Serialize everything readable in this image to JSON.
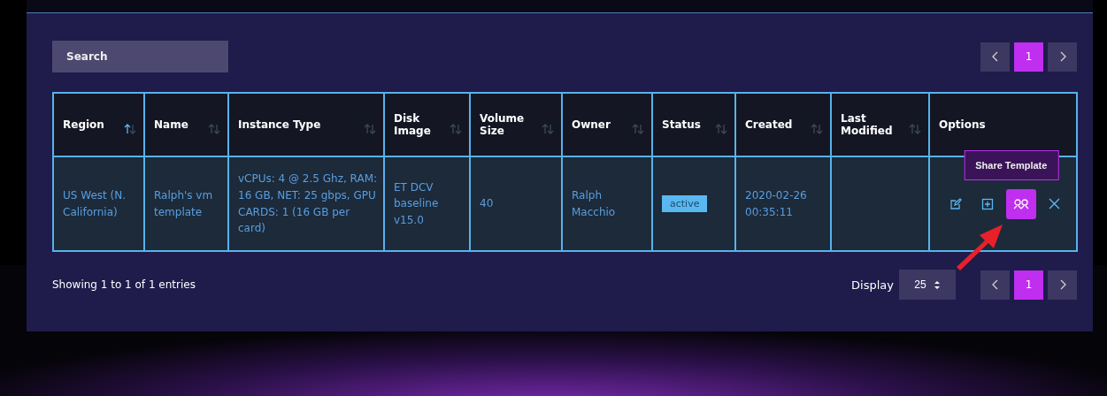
{
  "search": {
    "placeholder": "Search"
  },
  "pagination_top": {
    "pages": [
      {
        "label": "1",
        "selected": true
      }
    ]
  },
  "table": {
    "columns": [
      {
        "label": "Region",
        "sorted": true
      },
      {
        "label": "Name",
        "sorted": false
      },
      {
        "label": "Instance Type",
        "sorted": false
      },
      {
        "label": "Disk Image",
        "sorted": false
      },
      {
        "label": "Volume Size",
        "sorted": false
      },
      {
        "label": "Owner",
        "sorted": false
      },
      {
        "label": "Status",
        "sorted": false
      },
      {
        "label": "Created",
        "sorted": false
      },
      {
        "label": "Last Modified",
        "sorted": false
      },
      {
        "label": "Options"
      }
    ],
    "rows": [
      {
        "region": "US West (N. California)",
        "name": "Ralph's vm template",
        "instance_type": "vCPUs: 4 @ 2.5 Ghz, RAM: 16 GB, NET: 25 gbps, GPU CARDS: 1 (16 GB per card)",
        "disk_image": "ET DCV baseline v15.0",
        "volume_size": "40",
        "owner": "Ralph Macchio",
        "status": "active",
        "created": "2020-02-26 00:35:11",
        "actions": [
          {
            "kind": "edit",
            "highlighted": false
          },
          {
            "kind": "add",
            "highlighted": false
          },
          {
            "kind": "share",
            "highlighted": true,
            "tooltip": "Share Template"
          },
          {
            "kind": "delete",
            "highlighted": false
          }
        ]
      }
    ]
  },
  "footer": {
    "info": "Showing 1 to 1 of 1 entries",
    "display_label": "Display",
    "page_size": "25",
    "pages": [
      {
        "label": "1",
        "selected": true
      }
    ]
  }
}
